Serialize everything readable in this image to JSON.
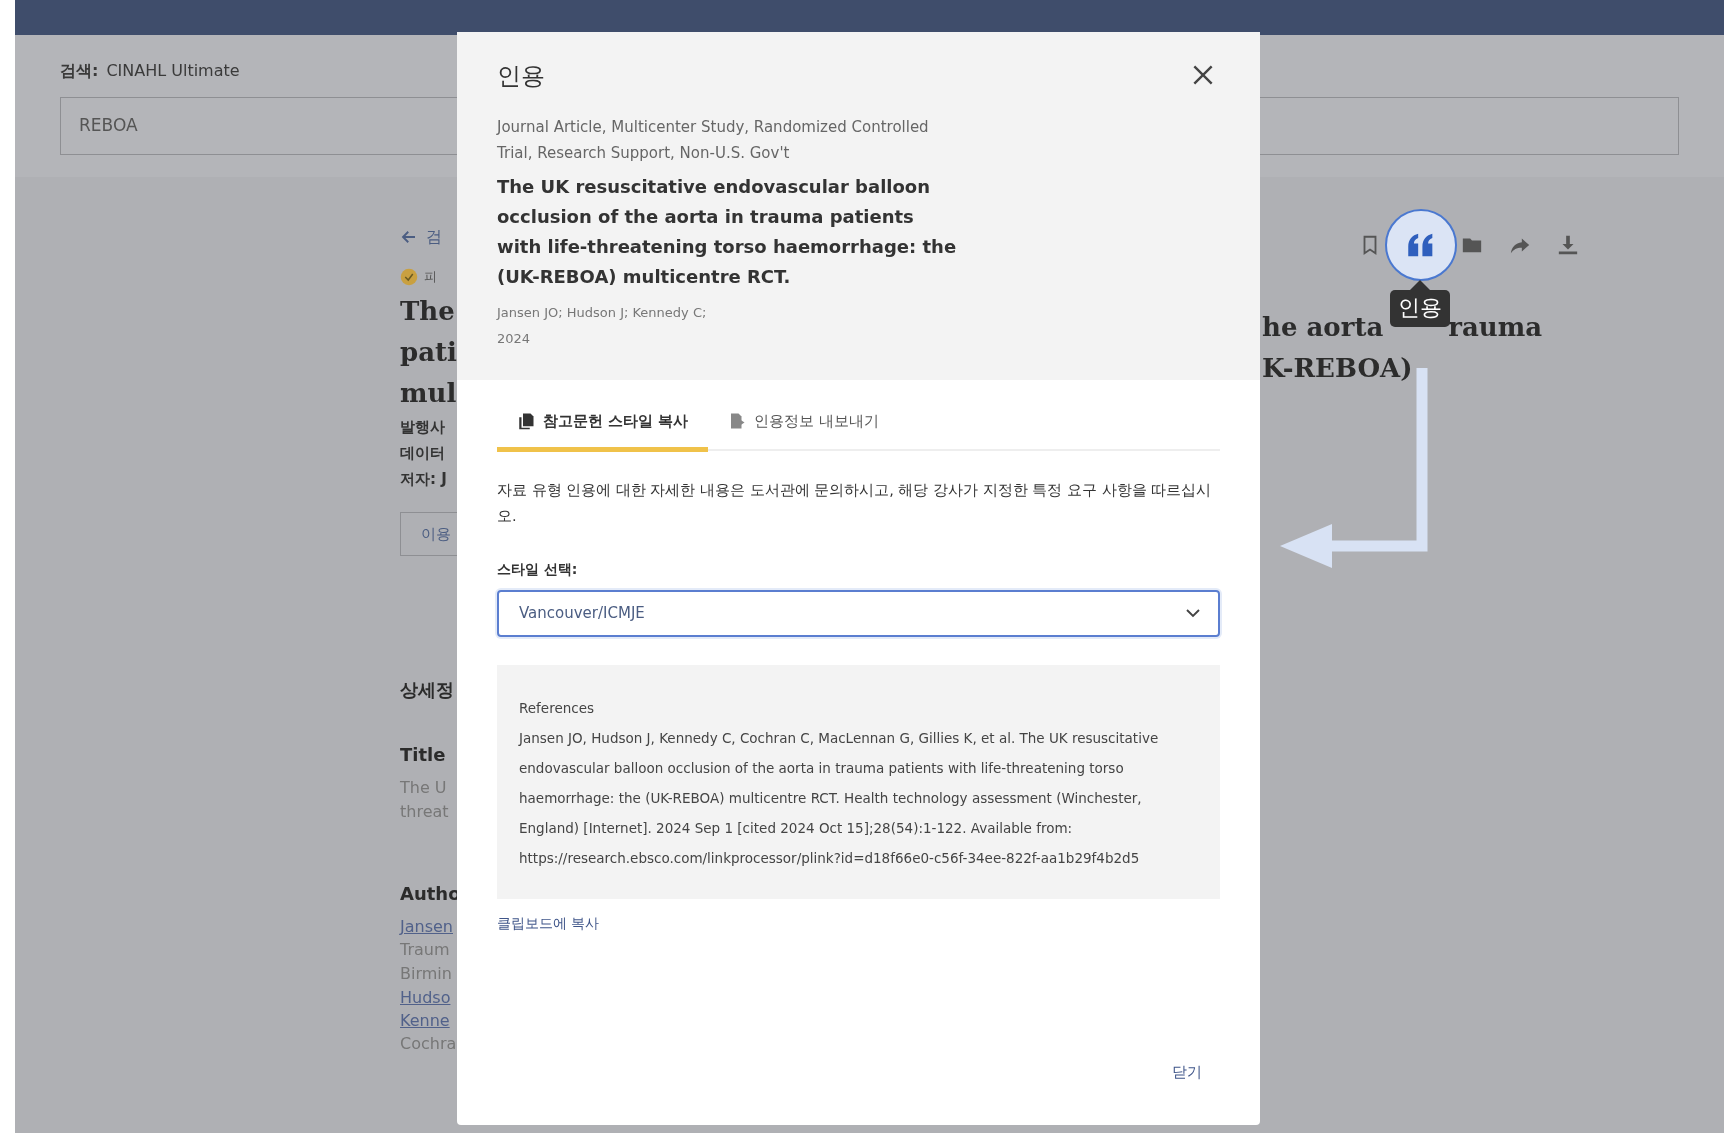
{
  "search": {
    "label": "검색:",
    "database": "CINAHL Ultimate",
    "query": "REBOA"
  },
  "article_left": {
    "back_link": "검",
    "badge": "피",
    "title_lines": [
      "The",
      "pati",
      "mul"
    ],
    "meta_lines": [
      "발행사",
      "데이터",
      "저자: J"
    ],
    "button": "이용",
    "details_heading": "상세정",
    "title_heading": "Title",
    "title_text_lines": [
      "The U",
      "threat"
    ],
    "authors_heading": "Autho",
    "author_lines": [
      {
        "text": "Jansen",
        "link": true
      },
      {
        "text": "Traum",
        "link": false
      },
      {
        "text": "Birmin",
        "link": false
      },
      {
        "text": "Hudso",
        "link": true
      },
      {
        "text": "Kenne",
        "link": true
      },
      {
        "text": "Cochra",
        "link": false
      }
    ]
  },
  "article_right": {
    "title_lines": [
      [
        "he aorta",
        "rauma"
      ],
      [
        "K-REBOA)"
      ]
    ]
  },
  "toolbar": [
    {
      "kind": "bookmark",
      "selected": false
    },
    {
      "kind": "cite",
      "selected": true
    },
    {
      "kind": "folder",
      "selected": false
    },
    {
      "kind": "share",
      "selected": false
    },
    {
      "kind": "download",
      "selected": false
    }
  ],
  "tooltip": "인용",
  "modal": {
    "title": "인용",
    "doc_type": "Journal Article, Multicenter Study, Randomized Controlled Trial, Research Support, Non-U.S. Gov't",
    "article_title": "The UK resuscitative endovascular balloon occlusion of the aorta in trauma patients with life-threatening torso haemorrhage: the (UK-REBOA) multicentre RCT.",
    "authors": "Jansen JO; Hudson J; Kennedy C;",
    "year": "2024",
    "tabs": [
      {
        "label": "참고문헌 스타일 복사",
        "kind": "copy",
        "selected": true
      },
      {
        "label": "인용정보 내보내기",
        "kind": "export",
        "selected": false
      }
    ],
    "instruction": "자료 유형 인용에 대한 자세한 내용은 도서관에 문의하시고, 해당 강사가 지정한 특정 요구 사항을 따르십시오.",
    "style_label": "스타일 선택:",
    "style_value": "Vancouver/ICMJE",
    "reference_heading": "References",
    "reference_text": "Jansen JO, Hudson J, Kennedy C, Cochran C, MacLennan G, Gillies K, et al. The UK resuscitative endovascular balloon occlusion of the aorta in trauma patients with life-threatening torso haemorrhage: the (UK-REBOA) multicentre RCT. Health technology assessment (Winchester, England) [Internet]. 2024 Sep 1 [cited 2024 Oct 15];28(54):1-122. Available from: https://research.ebsco.com/linkprocessor/plink?id=d18f66e0-c56f-34ee-822f-aa1b29f4b2d5",
    "copy_link": "클립보드에 복사",
    "close_button": "닫기"
  }
}
